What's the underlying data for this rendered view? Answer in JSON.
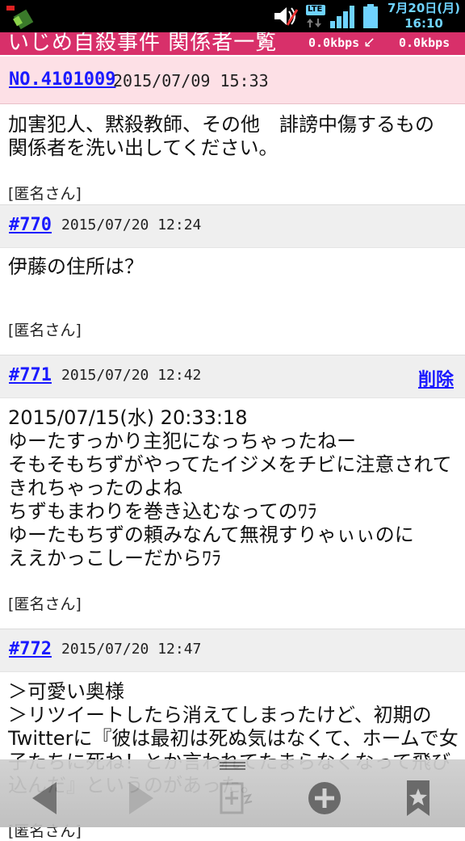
{
  "statusbar": {
    "date": "7月20日(月)",
    "time": "16:10",
    "lte_label": "LTE",
    "icons": [
      "app-icon",
      "volume-muted-icon",
      "lte-icon",
      "signal-icon",
      "battery-icon"
    ]
  },
  "titlebar": {
    "title": "いじめ自殺事件 関係者一覧",
    "upload_speed": "0.0kbps",
    "download_speed": "0.0kbps",
    "background": "#d8306a"
  },
  "thread": {
    "number": "NO.4101009",
    "date": "2015/07/09 15:33",
    "body": "加害犯人、黙殺教師、その他　誹謗中傷するもの　関係者を洗い出してください。",
    "author": "[匿名さん]"
  },
  "posts": [
    {
      "number": "#770",
      "date": "2015/07/20 12:24",
      "body": "伊藤の住所は？",
      "author": "[匿名さん]"
    },
    {
      "number": "#771",
      "date": "2015/07/20 12:42",
      "delete_label": "削除",
      "body": "2015/07/15(水) 20:33:18\nゆーたすっかり主犯になっちゃったねー\nそもそもちずがやってたイジメをチビに注意されてきれちゃったのよね\nちずもまわりを巻き込むなってのﾜﾗ\nゆーたもちずの頼みなんて無視すりゃぃぃのに\nええかっこしーだからﾜﾗ",
      "author": "[匿名さん]"
    },
    {
      "number": "#772",
      "date": "2015/07/20 12:47",
      "body": "＞可愛い奥様\n＞リツイートしたら消えてしまったけど、初期のTwitterに『彼は最初は死ぬ気はなくて、ホームで女子たちに死ね！とか言われてたまらなくなって飛び込んだ』というのがあった。",
      "author": "[匿名さん]"
    }
  ],
  "toolbar": {
    "icons": [
      "back-arrow-icon",
      "forward-arrow-icon",
      "new-tab-icon",
      "add-icon",
      "bookmark-icon"
    ]
  },
  "colors": {
    "link": "#1a1aff",
    "header_pink": "#fde0e6",
    "post_header_gray": "#efefef"
  }
}
